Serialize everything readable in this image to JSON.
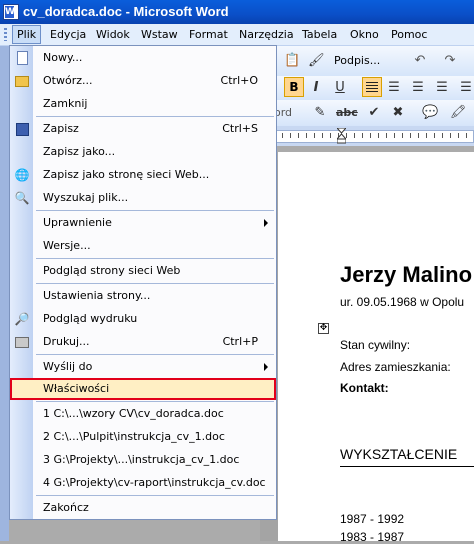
{
  "window": {
    "title": "cv_doradca.doc - Microsoft Word"
  },
  "menubar": {
    "items": [
      "Plik",
      "Edycja",
      "Widok",
      "Wstaw",
      "Format",
      "Narzędzia",
      "Tabela",
      "Okno",
      "Pomoc"
    ]
  },
  "toolbar": {
    "signature_label": "Podpis...",
    "style_fragment": "ord",
    "bold_label": "B"
  },
  "file_menu": {
    "items": [
      {
        "label": "Nowy...",
        "shortcut": "",
        "icon": "new-document-icon"
      },
      {
        "label": "Otwórz...",
        "shortcut": "Ctrl+O",
        "icon": "open-folder-icon"
      },
      {
        "label": "Zamknij",
        "shortcut": ""
      },
      {
        "label": "Zapisz",
        "shortcut": "Ctrl+S",
        "icon": "save-disk-icon"
      },
      {
        "label": "Zapisz jako...",
        "shortcut": ""
      },
      {
        "label": "Zapisz jako stronę sieci Web...",
        "shortcut": "",
        "icon": "web-page-icon"
      },
      {
        "label": "Wyszukaj plik...",
        "shortcut": "",
        "icon": "file-search-icon"
      },
      {
        "label": "Uprawnienie",
        "shortcut": "",
        "submenu": true
      },
      {
        "label": "Wersje...",
        "shortcut": ""
      },
      {
        "label": "Podgląd strony sieci Web",
        "shortcut": ""
      },
      {
        "label": "Ustawienia strony...",
        "shortcut": ""
      },
      {
        "label": "Podgląd wydruku",
        "shortcut": "",
        "icon": "print-preview-icon"
      },
      {
        "label": "Drukuj...",
        "shortcut": "Ctrl+P",
        "icon": "printer-icon"
      },
      {
        "label": "Wyślij do",
        "shortcut": "",
        "submenu": true
      },
      {
        "label": "Właściwości",
        "shortcut": "",
        "highlighted": true
      },
      {
        "label": "1 C:\\...\\wzory CV\\cv_doradca.doc",
        "shortcut": ""
      },
      {
        "label": "2 C:\\...\\Pulpit\\instrukcja_cv_1.doc",
        "shortcut": ""
      },
      {
        "label": "3 G:\\Projekty\\...\\instrukcja_cv_1.doc",
        "shortcut": ""
      },
      {
        "label": "4 G:\\Projekty\\cv-raport\\instrukcja_cv.doc",
        "shortcut": ""
      },
      {
        "label": "Zakończ",
        "shortcut": ""
      }
    ]
  },
  "document": {
    "name": "Jerzy Malino",
    "born": "ur. 09.05.1968 w Opolu",
    "lines": [
      "Stan cywilny:",
      "Adres zamieszkania:",
      "Kontakt:"
    ],
    "section": "WYKSZTAŁCENIE",
    "years": [
      "1987 - 1992",
      "1983 - 1987"
    ]
  },
  "colors": {
    "titlebar": "#0A5EDB",
    "menubar": "#E3EEFC",
    "highlight_fill": "#FFEFC4",
    "highlight_border": "#E2001A"
  }
}
